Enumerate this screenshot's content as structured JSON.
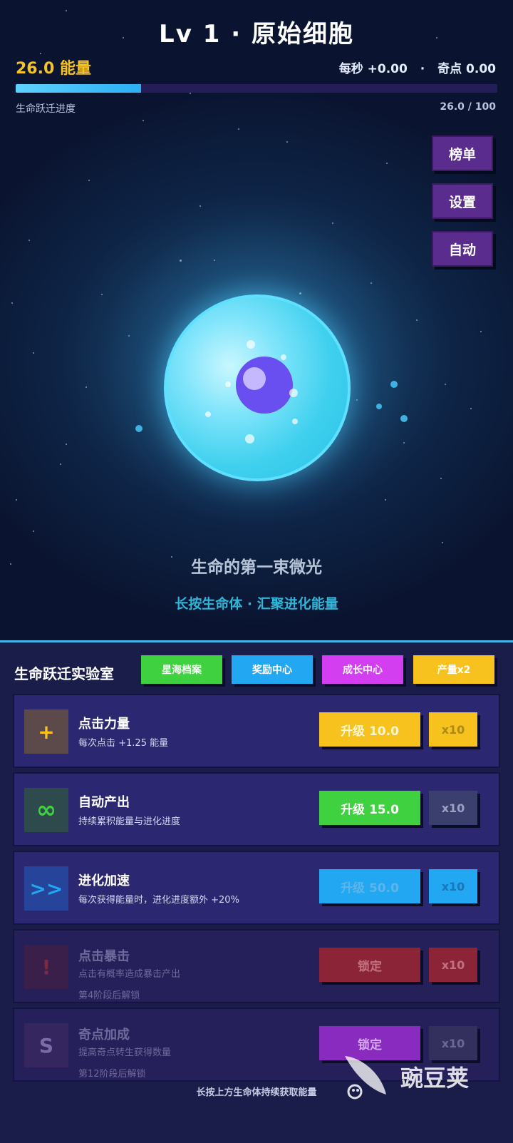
{
  "header": {
    "title": "Lv 1 · 原始细胞",
    "energy": "26.0 能量",
    "per_second": "每秒 +0.00",
    "separator": "·",
    "singularity": "奇点 0.00",
    "progress_label": "生命跃迁进度",
    "progress_value": "26.0 / 100",
    "progress_fraction": 0.26
  },
  "side_menu": {
    "leaderboard": "榜单",
    "settings": "设置",
    "auto": "自动"
  },
  "stage": {
    "name": "生命的第一束微光",
    "hint": "长按生命体 · 汇聚进化能量"
  },
  "panel": {
    "title": "生命跃迁实验室",
    "tabs": [
      {
        "label": "星海档案",
        "color": "#3fd13f"
      },
      {
        "label": "奖励中心",
        "color": "#22a8f2"
      },
      {
        "label": "成长中心",
        "color": "#d23ef0"
      },
      {
        "label": "产量x2",
        "color": "#f7c21e"
      }
    ],
    "upgrades": [
      {
        "icon": "+",
        "name": "点击力量",
        "desc": "每次点击 +1.25 能量",
        "lock_note": "",
        "button": "升级 10.0",
        "multi": "x10",
        "btn_color": "#f7c21e",
        "multi_color": "#f7c21e"
      },
      {
        "icon": "∞",
        "name": "自动产出",
        "desc": "持续累积能量与进化进度",
        "lock_note": "",
        "button": "升级 15.0",
        "multi": "x10",
        "btn_color": "#3fd13f",
        "multi_color": "#3a3f6e"
      },
      {
        "icon": ">>",
        "name": "进化加速",
        "desc": "每次获得能量时，进化进度额外 +20%",
        "lock_note": "",
        "button": "升级 50.0",
        "multi": "x10",
        "btn_color": "#22a8f2",
        "multi_color": "#22a8f2"
      },
      {
        "icon": "!",
        "name": "点击暴击",
        "desc": "点击有概率造成暴击产出",
        "lock_note": "第4阶段后解锁",
        "button": "锁定",
        "multi": "x10",
        "btn_color": "#8a2436",
        "multi_color": "#8a2436"
      },
      {
        "icon": "S",
        "name": "奇点加成",
        "desc": "提高奇点转生获得数量",
        "lock_note": "第12阶段后解锁",
        "button": "锁定",
        "multi": "x10",
        "btn_color": "#8a2bbf",
        "multi_color": "#33305e"
      }
    ],
    "footer_hint": "长按上方生命体持续获取能量"
  },
  "watermark": {
    "text": "豌豆荚"
  }
}
